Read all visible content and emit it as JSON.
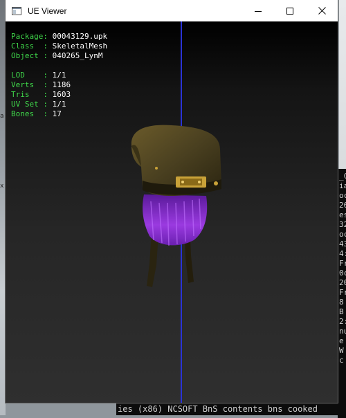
{
  "window": {
    "title": "UE Viewer",
    "controls": [
      "minimize-icon",
      "maximize-icon",
      "close-icon"
    ]
  },
  "info": {
    "group1": [
      {
        "label": "Package: ",
        "value": "00043129.upk"
      },
      {
        "label": "Class  : ",
        "value": "SkeletalMesh"
      },
      {
        "label": "Object : ",
        "value": "040265_LynM"
      }
    ],
    "group2": [
      {
        "label": "LOD    : ",
        "value": "1/1"
      },
      {
        "label": "Verts  : ",
        "value": "1186"
      },
      {
        "label": "Tris   : ",
        "value": "1603"
      },
      {
        "label": "UV Set : ",
        "value": "1/1"
      },
      {
        "label": "Bones  : ",
        "value": "17"
      }
    ]
  },
  "colors": {
    "label": "#3fd74a",
    "value": "#ffffff",
    "axis": "#2a33d6",
    "hat": "#4d4320",
    "hair": "#8a2fd0"
  },
  "console": {
    "lines": [
      "_C",
      "ia",
      "oc",
      "26",
      "es",
      "32",
      "oc",
      "43",
      "4:",
      "Fr",
      "",
      "0c",
      "20",
      "Fr",
      "8",
      "B",
      "2:",
      "nu",
      "e",
      "",
      "",
      "",
      "W",
      "c"
    ],
    "bottom_line": "ies (x86) NCSOFT BnS contents bns cooked"
  },
  "background": {
    "left_marks": [
      "a",
      "x"
    ]
  }
}
